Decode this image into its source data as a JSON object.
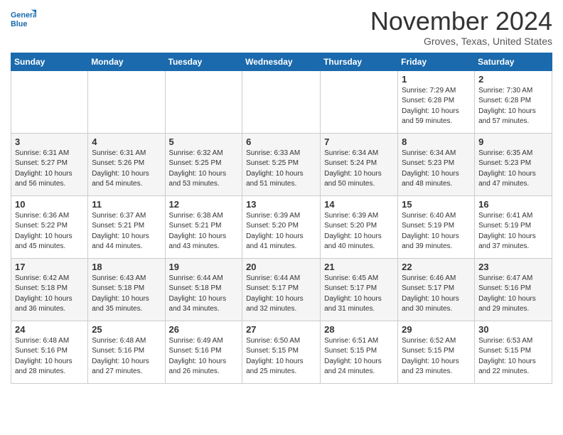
{
  "logo": {
    "line1": "General",
    "line2": "Blue"
  },
  "title": "November 2024",
  "location": "Groves, Texas, United States",
  "days_header": [
    "Sunday",
    "Monday",
    "Tuesday",
    "Wednesday",
    "Thursday",
    "Friday",
    "Saturday"
  ],
  "weeks": [
    [
      {
        "day": "",
        "info": ""
      },
      {
        "day": "",
        "info": ""
      },
      {
        "day": "",
        "info": ""
      },
      {
        "day": "",
        "info": ""
      },
      {
        "day": "",
        "info": ""
      },
      {
        "day": "1",
        "info": "Sunrise: 7:29 AM\nSunset: 6:28 PM\nDaylight: 10 hours\nand 59 minutes."
      },
      {
        "day": "2",
        "info": "Sunrise: 7:30 AM\nSunset: 6:28 PM\nDaylight: 10 hours\nand 57 minutes."
      }
    ],
    [
      {
        "day": "3",
        "info": "Sunrise: 6:31 AM\nSunset: 5:27 PM\nDaylight: 10 hours\nand 56 minutes."
      },
      {
        "day": "4",
        "info": "Sunrise: 6:31 AM\nSunset: 5:26 PM\nDaylight: 10 hours\nand 54 minutes."
      },
      {
        "day": "5",
        "info": "Sunrise: 6:32 AM\nSunset: 5:25 PM\nDaylight: 10 hours\nand 53 minutes."
      },
      {
        "day": "6",
        "info": "Sunrise: 6:33 AM\nSunset: 5:25 PM\nDaylight: 10 hours\nand 51 minutes."
      },
      {
        "day": "7",
        "info": "Sunrise: 6:34 AM\nSunset: 5:24 PM\nDaylight: 10 hours\nand 50 minutes."
      },
      {
        "day": "8",
        "info": "Sunrise: 6:34 AM\nSunset: 5:23 PM\nDaylight: 10 hours\nand 48 minutes."
      },
      {
        "day": "9",
        "info": "Sunrise: 6:35 AM\nSunset: 5:23 PM\nDaylight: 10 hours\nand 47 minutes."
      }
    ],
    [
      {
        "day": "10",
        "info": "Sunrise: 6:36 AM\nSunset: 5:22 PM\nDaylight: 10 hours\nand 45 minutes."
      },
      {
        "day": "11",
        "info": "Sunrise: 6:37 AM\nSunset: 5:21 PM\nDaylight: 10 hours\nand 44 minutes."
      },
      {
        "day": "12",
        "info": "Sunrise: 6:38 AM\nSunset: 5:21 PM\nDaylight: 10 hours\nand 43 minutes."
      },
      {
        "day": "13",
        "info": "Sunrise: 6:39 AM\nSunset: 5:20 PM\nDaylight: 10 hours\nand 41 minutes."
      },
      {
        "day": "14",
        "info": "Sunrise: 6:39 AM\nSunset: 5:20 PM\nDaylight: 10 hours\nand 40 minutes."
      },
      {
        "day": "15",
        "info": "Sunrise: 6:40 AM\nSunset: 5:19 PM\nDaylight: 10 hours\nand 39 minutes."
      },
      {
        "day": "16",
        "info": "Sunrise: 6:41 AM\nSunset: 5:19 PM\nDaylight: 10 hours\nand 37 minutes."
      }
    ],
    [
      {
        "day": "17",
        "info": "Sunrise: 6:42 AM\nSunset: 5:18 PM\nDaylight: 10 hours\nand 36 minutes."
      },
      {
        "day": "18",
        "info": "Sunrise: 6:43 AM\nSunset: 5:18 PM\nDaylight: 10 hours\nand 35 minutes."
      },
      {
        "day": "19",
        "info": "Sunrise: 6:44 AM\nSunset: 5:18 PM\nDaylight: 10 hours\nand 34 minutes."
      },
      {
        "day": "20",
        "info": "Sunrise: 6:44 AM\nSunset: 5:17 PM\nDaylight: 10 hours\nand 32 minutes."
      },
      {
        "day": "21",
        "info": "Sunrise: 6:45 AM\nSunset: 5:17 PM\nDaylight: 10 hours\nand 31 minutes."
      },
      {
        "day": "22",
        "info": "Sunrise: 6:46 AM\nSunset: 5:17 PM\nDaylight: 10 hours\nand 30 minutes."
      },
      {
        "day": "23",
        "info": "Sunrise: 6:47 AM\nSunset: 5:16 PM\nDaylight: 10 hours\nand 29 minutes."
      }
    ],
    [
      {
        "day": "24",
        "info": "Sunrise: 6:48 AM\nSunset: 5:16 PM\nDaylight: 10 hours\nand 28 minutes."
      },
      {
        "day": "25",
        "info": "Sunrise: 6:48 AM\nSunset: 5:16 PM\nDaylight: 10 hours\nand 27 minutes."
      },
      {
        "day": "26",
        "info": "Sunrise: 6:49 AM\nSunset: 5:16 PM\nDaylight: 10 hours\nand 26 minutes."
      },
      {
        "day": "27",
        "info": "Sunrise: 6:50 AM\nSunset: 5:15 PM\nDaylight: 10 hours\nand 25 minutes."
      },
      {
        "day": "28",
        "info": "Sunrise: 6:51 AM\nSunset: 5:15 PM\nDaylight: 10 hours\nand 24 minutes."
      },
      {
        "day": "29",
        "info": "Sunrise: 6:52 AM\nSunset: 5:15 PM\nDaylight: 10 hours\nand 23 minutes."
      },
      {
        "day": "30",
        "info": "Sunrise: 6:53 AM\nSunset: 5:15 PM\nDaylight: 10 hours\nand 22 minutes."
      }
    ]
  ]
}
